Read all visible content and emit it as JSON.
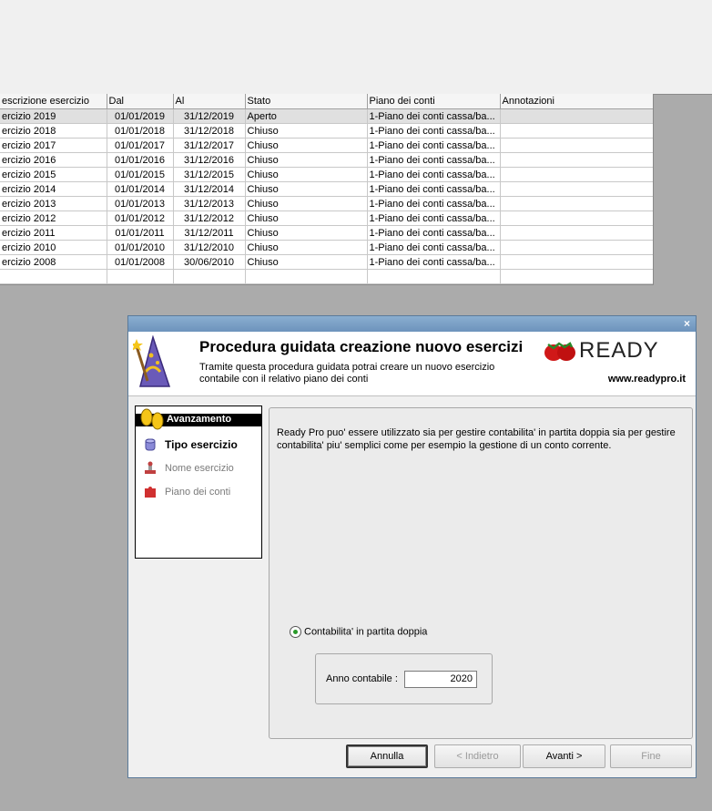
{
  "table": {
    "headers": [
      "escrizione esercizio",
      "Dal",
      "Al",
      "Stato",
      "Piano dei conti",
      "Annotazioni"
    ],
    "rows": [
      [
        "ercizio 2019",
        "01/01/2019",
        "31/12/2019",
        "Aperto",
        "1-Piano dei conti cassa/ba...",
        ""
      ],
      [
        "ercizio 2018",
        "01/01/2018",
        "31/12/2018",
        "Chiuso",
        "1-Piano dei conti cassa/ba...",
        ""
      ],
      [
        "ercizio 2017",
        "01/01/2017",
        "31/12/2017",
        "Chiuso",
        "1-Piano dei conti cassa/ba...",
        ""
      ],
      [
        "ercizio 2016",
        "01/01/2016",
        "31/12/2016",
        "Chiuso",
        "1-Piano dei conti cassa/ba...",
        ""
      ],
      [
        "ercizio 2015",
        "01/01/2015",
        "31/12/2015",
        "Chiuso",
        "1-Piano dei conti cassa/ba...",
        ""
      ],
      [
        "ercizio 2014",
        "01/01/2014",
        "31/12/2014",
        "Chiuso",
        "1-Piano dei conti cassa/ba...",
        ""
      ],
      [
        "ercizio 2013",
        "01/01/2013",
        "31/12/2013",
        "Chiuso",
        "1-Piano dei conti cassa/ba...",
        ""
      ],
      [
        "ercizio 2012",
        "01/01/2012",
        "31/12/2012",
        "Chiuso",
        "1-Piano dei conti cassa/ba...",
        ""
      ],
      [
        "ercizio 2011",
        "01/01/2011",
        "31/12/2011",
        "Chiuso",
        "1-Piano dei conti cassa/ba...",
        ""
      ],
      [
        "ercizio 2010",
        "01/01/2010",
        "31/12/2010",
        "Chiuso",
        "1-Piano dei conti cassa/ba...",
        ""
      ],
      [
        "ercizio 2008",
        "01/01/2008",
        "30/06/2010",
        "Chiuso",
        "1-Piano dei conti cassa/ba...",
        ""
      ],
      [
        "",
        "",
        "",
        "",
        "",
        ""
      ]
    ]
  },
  "dialog": {
    "close_label": "×",
    "title": "Procedura guidata creazione nuovo esercizi",
    "subtitle": "Tramite questa procedura guidata potrai creare un nuovo esercizio contabile con il relativo piano dei conti",
    "logo_text": "READY",
    "url": "www.readypro.it",
    "sidebar": {
      "header": "Avanzamento",
      "steps": [
        {
          "label": "Tipo esercizio",
          "icon": "database-icon"
        },
        {
          "label": "Nome esercizio",
          "icon": "stamp-icon"
        },
        {
          "label": "Piano dei conti",
          "icon": "puzzle-icon"
        }
      ]
    },
    "description": "Ready Pro puo' essere utilizzato sia per gestire contabilita' in partita doppia sia per gestire contabilita' piu' semplici come per esempio la gestione di un conto corrente.",
    "radio_label": "Contabilita' in partita doppia",
    "year_label": "Anno contabile :",
    "year_value": "2020",
    "buttons": {
      "cancel": "Annulla",
      "back": "< Indietro",
      "next": "Avanti >",
      "finish": "Fine"
    }
  },
  "colors": {
    "titlebar": "#6d93bc",
    "radio_dot": "#2a9a2a"
  }
}
